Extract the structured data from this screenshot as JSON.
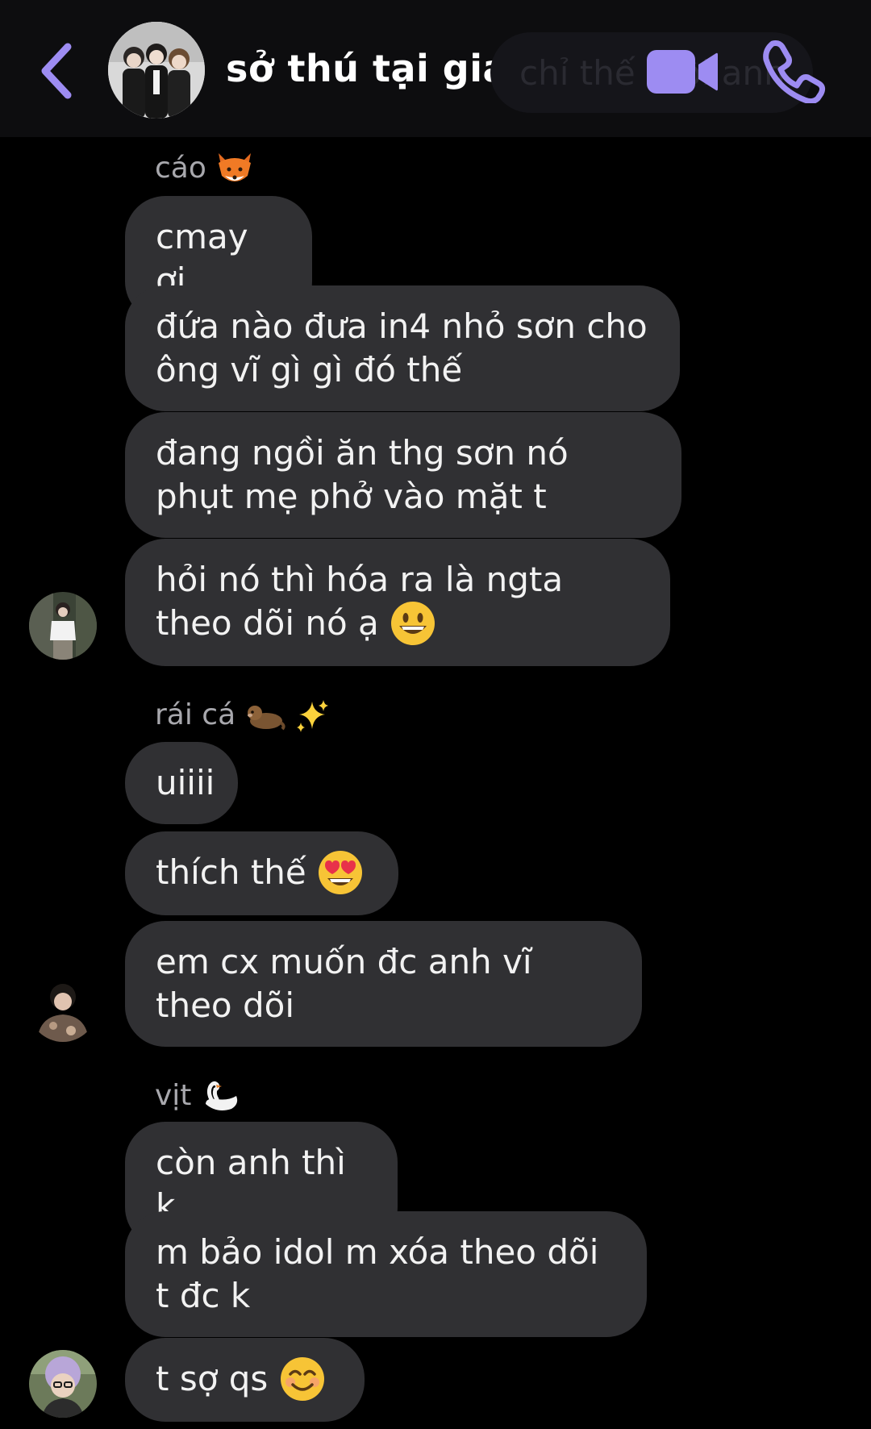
{
  "header": {
    "title": "sở thú tại gia",
    "pinned_text": "chỉ thế thôi anh",
    "back_label": "back",
    "video_label": "video-call",
    "call_label": "voice-call"
  },
  "messages": {
    "group1": {
      "sender": "cáo",
      "sender_emoji": "fox-emoji",
      "m1": "cmay ơi",
      "m2": "đứa nào đưa in4 nhỏ sơn cho ông vĩ gì gì đó thế",
      "m3": "đang ngồi ăn thg sơn nó phụt mẹ phở vào mặt t",
      "m4": "hỏi nó thì hóa ra là ngta theo dõi nó ạ"
    },
    "group2": {
      "sender": "rái cá",
      "sender_emoji": "otter-sparkles-emoji",
      "m1": "uiiii",
      "m2": "thích thế",
      "m3": "em cx muốn đc anh vĩ theo dõi"
    },
    "group3": {
      "sender": "vịt",
      "sender_emoji": "swan-emoji",
      "m1": "còn anh thì k",
      "m2": "m bảo idol m xóa theo dõi t đc k",
      "m3": "t sợ qs"
    }
  },
  "colors": {
    "accent": "#9d8cf2",
    "bubble": "#303033",
    "header_bg": "#0d0d0f",
    "background": "#000000",
    "sender_name": "#a8a8ad"
  }
}
